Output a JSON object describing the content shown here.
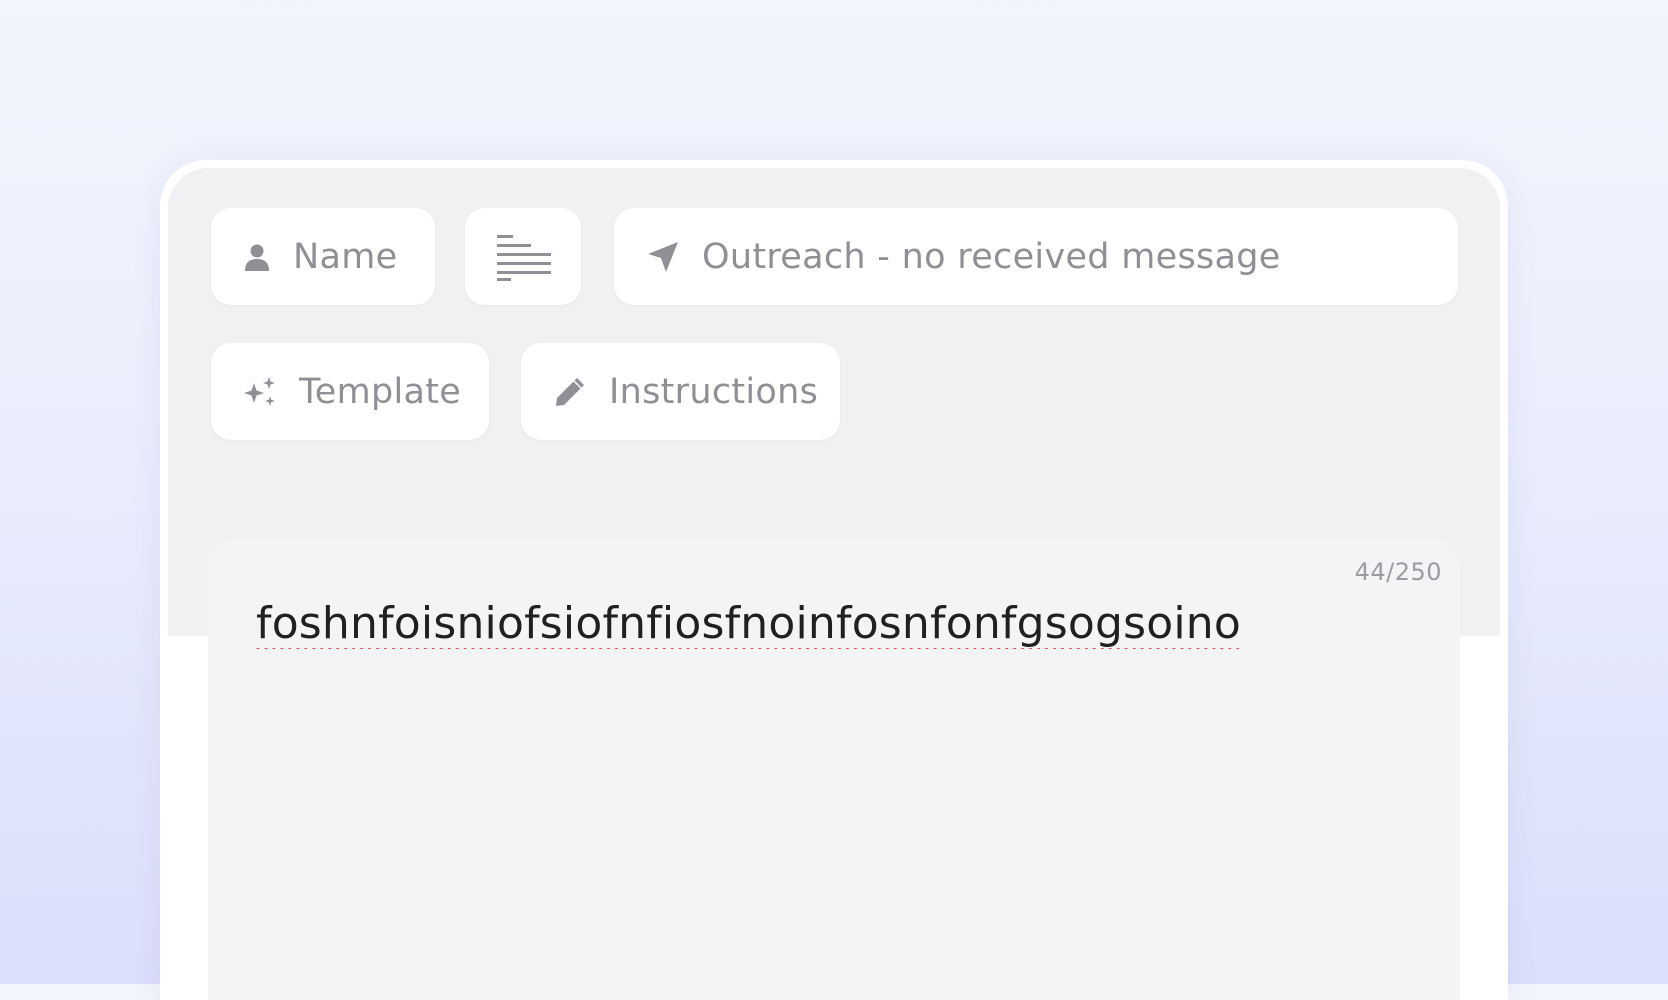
{
  "toolbar": {
    "name_label": "Name",
    "outreach_label": "Outreach - no received message",
    "template_label": "Template",
    "instructions_label": "Instructions"
  },
  "editor": {
    "counter": "44/250",
    "message_text": "foshnfoisniofsiofnfiosfnoinfosnfonfgsogsoino"
  },
  "icons": {
    "name": "person-icon",
    "format": "text-align-icon",
    "outreach": "send-arrow-icon",
    "template": "sparkles-icon",
    "instructions": "pencil-icon"
  },
  "colors": {
    "chip_text": "#8e9095",
    "toolbar_bg": "#f0f1f3",
    "editor_bg": "#f3f4f5",
    "spell_error": "#e53935"
  }
}
